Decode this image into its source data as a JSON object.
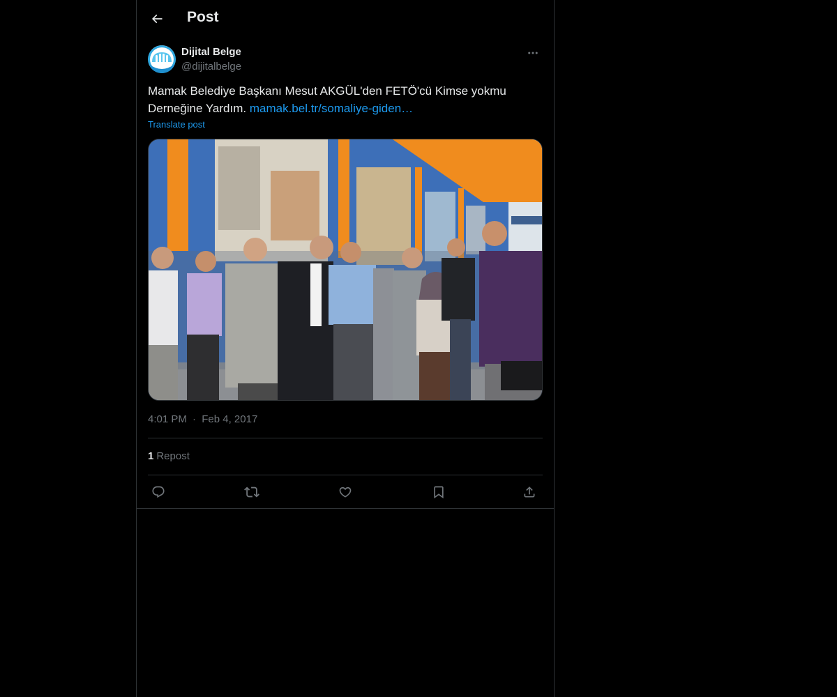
{
  "header": {
    "title": "Post",
    "back_icon": "arrow-left-icon"
  },
  "author": {
    "name": "Dijital Belge",
    "handle": "@dijitalbelge",
    "more_icon": "more-horizontal-icon"
  },
  "post": {
    "text": "Mamak Belediye Başkanı Mesut AKGÜL'den FETÖ'cü Kimse yokmu Derneğine Yardım. ",
    "link_text": "mamak.bel.tr/somaliye-giden…",
    "translate_label": "Translate post",
    "time": "4:01 PM",
    "separator": "·",
    "date": "Feb 4, 2017"
  },
  "stats": {
    "reposts_count": "1",
    "reposts_label": "Repost"
  },
  "actions": [
    {
      "name": "reply-icon"
    },
    {
      "name": "repost-icon"
    },
    {
      "name": "like-icon"
    },
    {
      "name": "bookmark-icon"
    },
    {
      "name": "share-icon"
    }
  ],
  "colors": {
    "background": "#000000",
    "text": "#e7e9ea",
    "muted": "#71767b",
    "accent": "#1d9bf0",
    "border": "#2f3336"
  }
}
